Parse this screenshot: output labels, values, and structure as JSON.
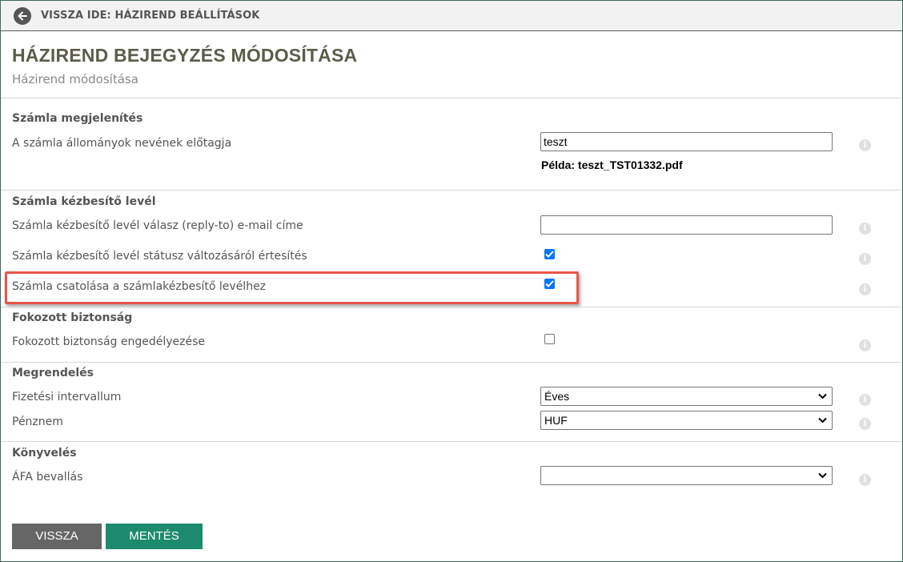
{
  "topbar": {
    "back_label": "VISSZA IDE: HÁZIREND BEÁLLÍTÁSOK"
  },
  "header": {
    "title": "HÁZIREND BEJEGYZÉS MÓDOSÍTÁSA",
    "subtitle": "Házirend módosítása"
  },
  "sections": {
    "invoice_display": {
      "title": "Számla megjelenítés",
      "prefix_label": "A számla állományok nevének előtagja",
      "prefix_value": "teszt",
      "example": "Példa: teszt_TST01332.pdf"
    },
    "delivery_letter": {
      "title": "Számla kézbesítő levél",
      "reply_to_label": "Számla kézbesítő levél válasz (reply-to) e-mail címe",
      "reply_to_value": "",
      "status_notify_label": "Számla kézbesítő levél státusz változásáról értesítés",
      "status_notify_checked": true,
      "attach_label": "Számla csatolása a számlakézbesítő levélhez",
      "attach_checked": true
    },
    "security": {
      "title": "Fokozott biztonság",
      "enable_label": "Fokozott biztonság engedélyezése",
      "enable_checked": false
    },
    "order": {
      "title": "Megrendelés",
      "interval_label": "Fizetési intervallum",
      "interval_value": "Éves",
      "currency_label": "Pénznem",
      "currency_value": "HUF"
    },
    "accounting": {
      "title": "Könyvelés",
      "vat_label": "ÁFA bevallás",
      "vat_value": ""
    }
  },
  "info_glyph": "i",
  "icons": {
    "back": "arrow-left-circle-icon",
    "info": "info-circle-icon",
    "dropdown": "chevron-down-icon",
    "check": "checkmark-icon"
  },
  "buttons": {
    "back": "VISSZA",
    "save": "MENTÉS"
  },
  "colors": {
    "save_button": "#1d8a6e",
    "back_button": "#666666",
    "highlight": "#e8564a",
    "checkbox": "#0075ff"
  }
}
